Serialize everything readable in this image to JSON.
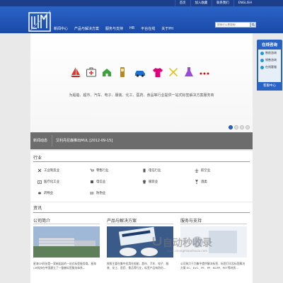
{
  "topbar": {
    "links": [
      "首页",
      "加入收藏",
      "联系我们",
      "ENGLISH"
    ]
  },
  "header": {
    "nav": [
      "新闻中心",
      "产品与解决方案",
      "服务与支持",
      "HR",
      "平台在线",
      "关于PH"
    ],
    "search_placeholder": "搜索可以是搜索!"
  },
  "banner": {
    "icons": [
      "sailboat-icon",
      "medical-kit-icon",
      "house-icon",
      "phone-icon",
      "car-icon",
      "tshirt-icon",
      "tools-icon",
      "flask-icon",
      "more-dots-icon"
    ],
    "slogan": "为船舶、超市、汽车、电子、服装、化工、医药、食品等行业提供一站式标签解决方案服务商",
    "slide_count": 4,
    "active_slide": 1
  },
  "consult": {
    "title": "在线咨询",
    "items": [
      "售前咨询",
      "销售咨询",
      "在线客服"
    ],
    "footer": "客服中心"
  },
  "newsbar": {
    "label": "新闻动态",
    "item": "艾利丹尼森推出MUL [2012-09-15]"
  },
  "industry": {
    "title": "行业",
    "items": [
      "工业制造业",
      "零售行业",
      "电信行业",
      "航空业",
      "医疗化工业",
      "电信业",
      "服装业",
      "酒类",
      "药物业",
      "防伪业"
    ]
  },
  "news": {
    "title": "资讯"
  },
  "columns": [
    {
      "title": "公司简介",
      "text": "星海CR科技是一家新起起的一站式标签服务商。星海CR科技在中国建立了一整套标签服务体系..."
    },
    {
      "title": "产品与解决方案",
      "text": "按照主要在集中应用在船舶、超市、汽车、电子、服装、化工、医药、食品等行业，标签产品有防伪..."
    },
    {
      "title": "服务与支持",
      "text": "公司致力于为集中提供解决标签、标签打印及标签解决方案 EC、EVC、PE、PP、BOPP、PET等材质..."
    }
  ],
  "watermark": {
    "text": "自动秒收录",
    "sub": "www.zidongmiaoshoulu.com"
  },
  "colors": {
    "nav_blue": "#1a4aa8",
    "topbar": "#1b3f8a",
    "newsbar": "#6c6c6c"
  }
}
